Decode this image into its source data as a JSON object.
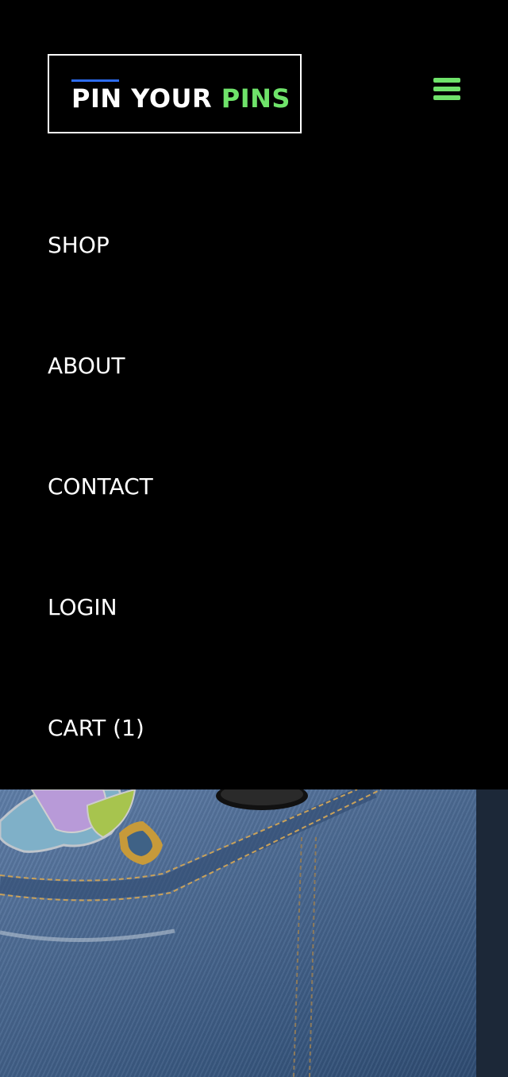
{
  "brand": {
    "logo_part1": "PIN YOUR ",
    "logo_part2": "PINS",
    "accent_color": "#6fe36a",
    "bar_color": "#2d6cf0"
  },
  "menu_icon": "hamburger-menu-icon",
  "nav": {
    "items": [
      {
        "label": "SHOP"
      },
      {
        "label": "ABOUT"
      },
      {
        "label": "CONTACT"
      },
      {
        "label": "LOGIN"
      },
      {
        "label": "CART (1)"
      }
    ]
  },
  "hero": {
    "alt": "Denim jacket with enamel pins"
  }
}
